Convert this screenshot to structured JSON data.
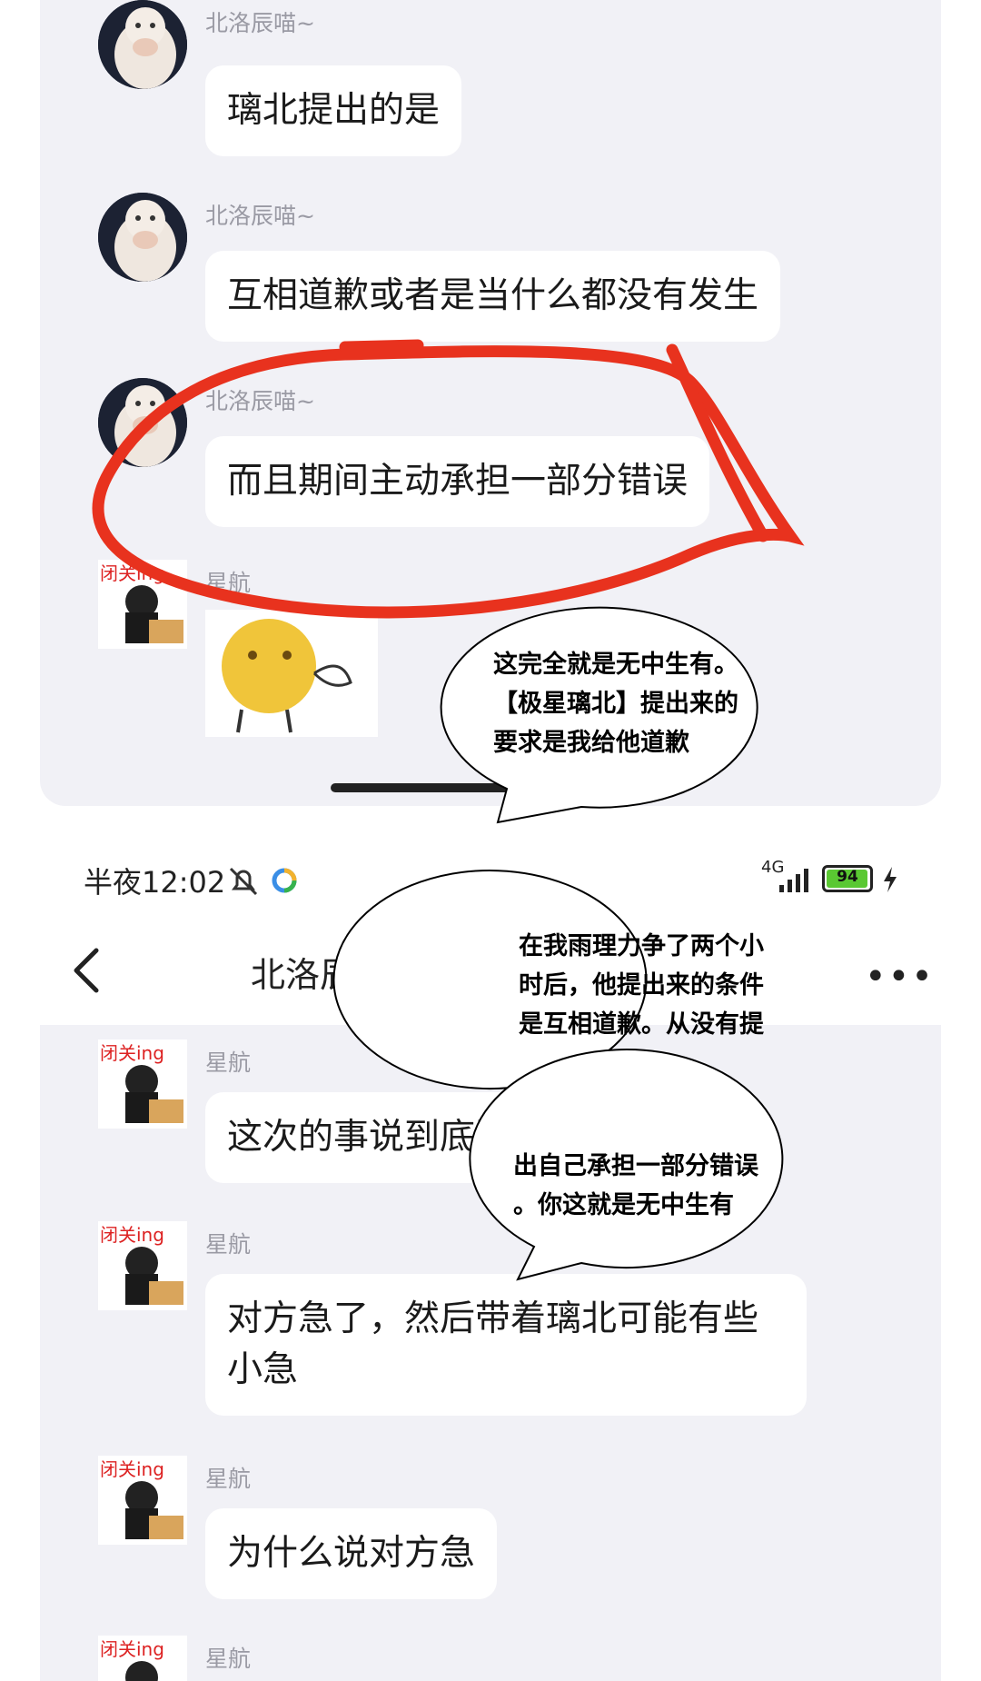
{
  "top_messages": [
    {
      "sender": "北洛辰喵~",
      "text": "璃北提出的是",
      "avatar": "cat-avatar"
    },
    {
      "sender": "北洛辰喵~",
      "text": "互相道歉或者是当什么都没有发生",
      "avatar": "cat-avatar"
    },
    {
      "sender": "北洛辰喵~",
      "text": "而且期间主动承担一部分错误",
      "avatar": "cat-avatar"
    },
    {
      "sender": "星航",
      "text": "",
      "avatar": "boy-avatar",
      "sticker": "yellow-face-sticker"
    }
  ],
  "status_bar": {
    "time": "半夜12:02",
    "network": "4G",
    "battery": "94"
  },
  "header": {
    "title": "北洛辰和星航的",
    "back_icon": "chevron-left-icon",
    "more_icon": "more-icon"
  },
  "messages": [
    {
      "sender": "星航",
      "text": "这次的事说到底还"
    },
    {
      "sender": "星航",
      "text": "对方急了，然后带着璃北可能有些",
      "text2": "小急"
    },
    {
      "sender": "星航",
      "text": "为什么说对方急"
    },
    {
      "sender": "星航",
      "text": ""
    }
  ],
  "annotations": {
    "callout1": "这完全就是无中生有。\n【极星璃北】提出来的\n要求是我给他道歉",
    "callout2": "在我雨理力争了两个小\n时后，他提出来的条件\n是互相道歉。从没有提",
    "callout3": "出自己承担一部分错误\n。你这就是无中生有"
  },
  "colors": {
    "panel_bg": "#f1f1f6",
    "bubble_bg": "#ffffff",
    "circle_red": "#e8321e",
    "battery_green": "#5ac832"
  }
}
